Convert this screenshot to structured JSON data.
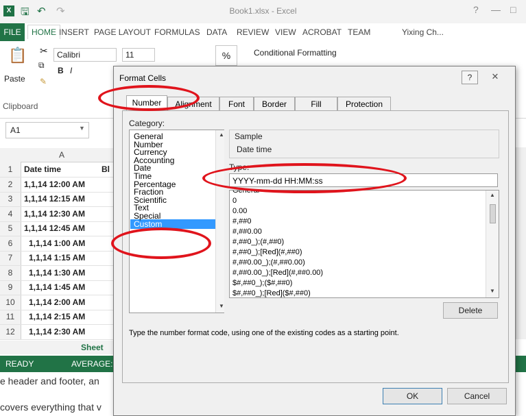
{
  "excel": {
    "title": "Book1.xlsx - Excel",
    "logo": "X",
    "user": "Yixing Ch...",
    "tabs": [
      "FILE",
      "HOME",
      "INSERT",
      "PAGE LAYOUT",
      "FORMULAS",
      "DATA",
      "REVIEW",
      "VIEW",
      "ACROBAT",
      "TEAM"
    ],
    "font_name": "Calibri",
    "font_size": "11",
    "paste_label": "Paste",
    "clipboard_label": "Clipboard",
    "conditional_formatting": "Conditional Formatting",
    "name_box": "A1",
    "column_a": "A",
    "status_ready": "READY",
    "status_average": "AVERAGE:",
    "sheet_tab": "Sheet",
    "cell_b1": "Bl",
    "rows": [
      {
        "num": "1",
        "value": "Date time"
      },
      {
        "num": "2",
        "value": "1,1,14 12:00 AM"
      },
      {
        "num": "3",
        "value": "1,1,14 12:15 AM"
      },
      {
        "num": "4",
        "value": "1,1,14 12:30 AM"
      },
      {
        "num": "5",
        "value": "1,1,14 12:45 AM"
      },
      {
        "num": "6",
        "value": "1,1,14 1:00 AM"
      },
      {
        "num": "7",
        "value": "1,1,14 1:15 AM"
      },
      {
        "num": "8",
        "value": "1,1,14 1:30 AM"
      },
      {
        "num": "9",
        "value": "1,1,14 1:45 AM"
      },
      {
        "num": "10",
        "value": "1,1,14 2:00 AM"
      },
      {
        "num": "11",
        "value": "1,1,14 2:15 AM"
      },
      {
        "num": "12",
        "value": "1,1,14 2:30 AM"
      }
    ],
    "bottom_text_1": "e header and footer, an",
    "bottom_text_2": "covers everything that v"
  },
  "dialog": {
    "title": "Format Cells",
    "help": "?",
    "close": "✕",
    "tabs": [
      "Number",
      "Alignment",
      "Font",
      "Border",
      "Fill",
      "Protection"
    ],
    "category_label": "Category:",
    "categories": [
      "General",
      "Number",
      "Currency",
      "Accounting",
      "Date",
      "Time",
      "Percentage",
      "Fraction",
      "Scientific",
      "Text",
      "Special",
      "Custom"
    ],
    "selected_category": "Custom",
    "sample_label": "Sample",
    "sample_value": "Date time",
    "type_label": "Type:",
    "type_value": "YYYY-mm-dd HH:MM:ss",
    "codes": [
      "General",
      "0",
      "0.00",
      "#,##0",
      "#,##0.00",
      "#,##0_);(#,##0)",
      "#,##0_);[Red](#,##0)",
      "#,##0.00_);(#,##0.00)",
      "#,##0.00_);[Red](#,##0.00)",
      "$#,##0_);($#,##0)",
      "$#,##0_);[Red]($#,##0)"
    ],
    "delete_label": "Delete",
    "hint": "Type the number format code, using one of the existing codes as a starting point.",
    "ok_label": "OK",
    "cancel_label": "Cancel"
  },
  "colors": {
    "excel_green": "#217346",
    "selection_blue": "#3399ff",
    "annotation_red": "#e0141c"
  }
}
